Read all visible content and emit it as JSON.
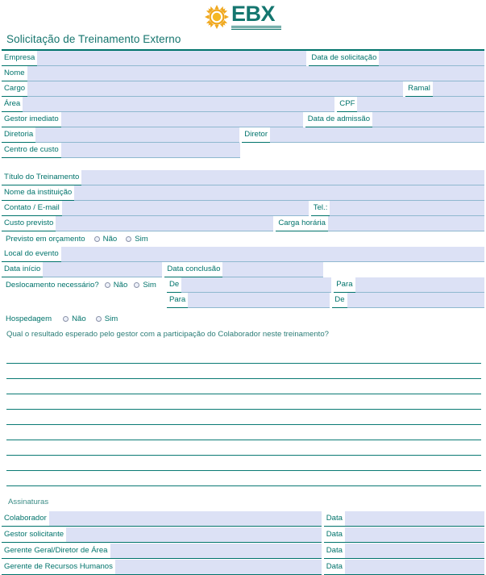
{
  "brand": {
    "logo_text": "EBX",
    "sun_icon": "sun-icon",
    "accent_teal": "#00736b",
    "sun_orange": "#f5a623",
    "field_fill": "#dce1f5"
  },
  "header": {
    "title": "Solicitação de Treinamento Externo"
  },
  "employee_section": {
    "empresa_label": "Empresa",
    "empresa_value": "",
    "data_solicitacao_label": "Data de solicitação",
    "data_solicitacao_value": "",
    "nome_label": "Nome",
    "nome_value": "",
    "cargo_label": "Cargo",
    "cargo_value": "",
    "ramal_label": "Ramal",
    "ramal_value": "",
    "area_label": "Área",
    "area_value": "",
    "cpf_label": "CPF",
    "cpf_value": "",
    "gestor_label": "Gestor imediato",
    "gestor_value": "",
    "data_admissao_label": "Data de admissão",
    "data_admissao_value": "",
    "diretoria_label": "Diretoria",
    "diretoria_value": "",
    "diretor_label": "Diretor",
    "diretor_value": "",
    "centro_custo_label": "Centro de custo",
    "centro_custo_value": ""
  },
  "training_section": {
    "titulo_label": "Título do Treinamento",
    "titulo_value": "",
    "instituicao_label": "Nome da instituição",
    "instituicao_value": "",
    "contato_label": "Contato / E-mail",
    "contato_value": "",
    "tel_label": "Tel.:",
    "tel_value": "",
    "custo_label": "Custo previsto",
    "custo_value": "",
    "carga_label": "Carga horária",
    "carga_value": "",
    "orcamento_label": "Previsto em orçamento",
    "orcamento_options": [
      "Não",
      "Sim"
    ],
    "local_label": "Local do evento",
    "local_value": "",
    "data_inicio_label": "Data início",
    "data_inicio_value": "",
    "data_conclusao_label": "Data conclusão",
    "data_conclusao_value": ""
  },
  "travel_section": {
    "deslocamento_label": "Deslocamento necessário?",
    "deslocamento_options": [
      "Não",
      "Sim"
    ],
    "ida_de_label": "De",
    "ida_de_value": "",
    "ida_para_label": "Para",
    "ida_para_value": "",
    "volta_para_label": "Para",
    "volta_para_value": "",
    "volta_de_label": "De",
    "volta_de_value": "",
    "hospedagem_label": "Hospedagem",
    "hospedagem_options": [
      "Não",
      "Sim"
    ]
  },
  "result_section": {
    "question": "Qual o resultado esperado pelo gestor com a participação do Colaborador neste treinamento?",
    "line_count": 9,
    "answer_lines": [
      "",
      "",
      "",
      "",
      "",
      "",
      "",
      "",
      ""
    ]
  },
  "signatures_section": {
    "title": "Assinaturas",
    "date_label": "Data",
    "rows": [
      {
        "label": "Colaborador",
        "signature": "",
        "date": ""
      },
      {
        "label": "Gestor solicitante",
        "signature": "",
        "date": ""
      },
      {
        "label": "Gerente Geral/Diretor de Área",
        "signature": "",
        "date": ""
      },
      {
        "label": "Gerente de Recursos Humanos",
        "signature": "",
        "date": ""
      }
    ]
  }
}
